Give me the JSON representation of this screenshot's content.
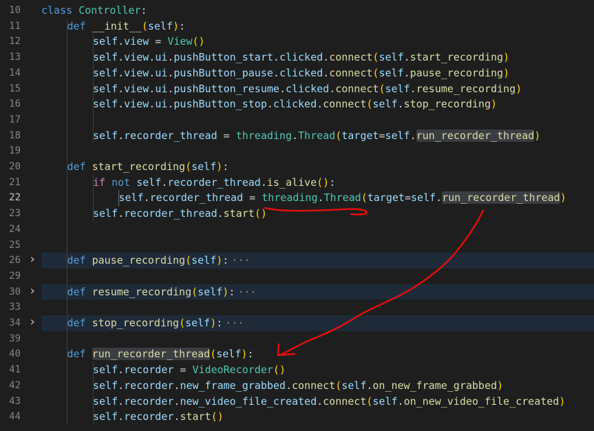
{
  "lines": [
    {
      "n": "10",
      "indent": 0,
      "tokens": [
        [
          "kw",
          "class"
        ],
        [
          "op",
          " "
        ],
        [
          "cls",
          "Controller"
        ],
        [
          "op",
          ":"
        ]
      ]
    },
    {
      "n": "11",
      "indent": 1,
      "tokens": [
        [
          "kw",
          "def"
        ],
        [
          "op",
          " "
        ],
        [
          "fn",
          "__init__"
        ],
        [
          "p1",
          "("
        ],
        [
          "var",
          "self"
        ],
        [
          "p1",
          ")"
        ],
        [
          "op",
          ":"
        ]
      ]
    },
    {
      "n": "12",
      "indent": 2,
      "tokens": [
        [
          "var",
          "self"
        ],
        [
          "op",
          "."
        ],
        [
          "var",
          "view"
        ],
        [
          "op",
          " = "
        ],
        [
          "cls",
          "View"
        ],
        [
          "p1",
          "()"
        ]
      ]
    },
    {
      "n": "13",
      "indent": 2,
      "tokens": [
        [
          "var",
          "self"
        ],
        [
          "op",
          "."
        ],
        [
          "var",
          "view"
        ],
        [
          "op",
          "."
        ],
        [
          "var",
          "ui"
        ],
        [
          "op",
          "."
        ],
        [
          "var",
          "pushButton_start"
        ],
        [
          "op",
          "."
        ],
        [
          "var",
          "clicked"
        ],
        [
          "op",
          "."
        ],
        [
          "fn",
          "connect"
        ],
        [
          "p1",
          "("
        ],
        [
          "var",
          "self"
        ],
        [
          "op",
          "."
        ],
        [
          "fn",
          "start_recording"
        ],
        [
          "p1",
          ")"
        ]
      ]
    },
    {
      "n": "14",
      "indent": 2,
      "tokens": [
        [
          "var",
          "self"
        ],
        [
          "op",
          "."
        ],
        [
          "var",
          "view"
        ],
        [
          "op",
          "."
        ],
        [
          "var",
          "ui"
        ],
        [
          "op",
          "."
        ],
        [
          "var",
          "pushButton_pause"
        ],
        [
          "op",
          "."
        ],
        [
          "var",
          "clicked"
        ],
        [
          "op",
          "."
        ],
        [
          "fn",
          "connect"
        ],
        [
          "p1",
          "("
        ],
        [
          "var",
          "self"
        ],
        [
          "op",
          "."
        ],
        [
          "fn",
          "pause_recording"
        ],
        [
          "p1",
          ")"
        ]
      ]
    },
    {
      "n": "15",
      "indent": 2,
      "tokens": [
        [
          "var",
          "self"
        ],
        [
          "op",
          "."
        ],
        [
          "var",
          "view"
        ],
        [
          "op",
          "."
        ],
        [
          "var",
          "ui"
        ],
        [
          "op",
          "."
        ],
        [
          "var",
          "pushButton_resume"
        ],
        [
          "op",
          "."
        ],
        [
          "var",
          "clicked"
        ],
        [
          "op",
          "."
        ],
        [
          "fn",
          "connect"
        ],
        [
          "p1",
          "("
        ],
        [
          "var",
          "self"
        ],
        [
          "op",
          "."
        ],
        [
          "fn",
          "resume_recording"
        ],
        [
          "p1",
          ")"
        ]
      ]
    },
    {
      "n": "16",
      "indent": 2,
      "tokens": [
        [
          "var",
          "self"
        ],
        [
          "op",
          "."
        ],
        [
          "var",
          "view"
        ],
        [
          "op",
          "."
        ],
        [
          "var",
          "ui"
        ],
        [
          "op",
          "."
        ],
        [
          "var",
          "pushButton_stop"
        ],
        [
          "op",
          "."
        ],
        [
          "var",
          "clicked"
        ],
        [
          "op",
          "."
        ],
        [
          "fn",
          "connect"
        ],
        [
          "p1",
          "("
        ],
        [
          "var",
          "self"
        ],
        [
          "op",
          "."
        ],
        [
          "fn",
          "stop_recording"
        ],
        [
          "p1",
          ")"
        ]
      ]
    },
    {
      "n": "17",
      "indent": 2,
      "tokens": []
    },
    {
      "n": "18",
      "indent": 2,
      "tokens": [
        [
          "var",
          "self"
        ],
        [
          "op",
          "."
        ],
        [
          "var",
          "recorder_thread"
        ],
        [
          "op",
          " = "
        ],
        [
          "cls",
          "threading"
        ],
        [
          "op",
          "."
        ],
        [
          "cls",
          "Thread"
        ],
        [
          "p1",
          "("
        ],
        [
          "var",
          "target"
        ],
        [
          "op",
          "="
        ],
        [
          "var",
          "self"
        ],
        [
          "op",
          "."
        ],
        [
          "fn",
          "run_recorder_thread",
          "hl"
        ],
        [
          "p1",
          ")"
        ]
      ]
    },
    {
      "n": "19",
      "indent": 1,
      "tokens": []
    },
    {
      "n": "20",
      "indent": 1,
      "tokens": [
        [
          "kw",
          "def"
        ],
        [
          "op",
          " "
        ],
        [
          "fn",
          "start_recording"
        ],
        [
          "p1",
          "("
        ],
        [
          "var",
          "self"
        ],
        [
          "p1",
          ")"
        ],
        [
          "op",
          ":"
        ]
      ]
    },
    {
      "n": "21",
      "indent": 2,
      "tokens": [
        [
          "ctl",
          "if"
        ],
        [
          "op",
          " "
        ],
        [
          "kw",
          "not"
        ],
        [
          "op",
          " "
        ],
        [
          "var",
          "self"
        ],
        [
          "op",
          "."
        ],
        [
          "var",
          "recorder_thread"
        ],
        [
          "op",
          "."
        ],
        [
          "fn",
          "is_alive"
        ],
        [
          "p1",
          "()"
        ],
        [
          "op",
          ":"
        ]
      ]
    },
    {
      "n": "22",
      "indent": 3,
      "active": true,
      "tokens": [
        [
          "var",
          "self"
        ],
        [
          "op",
          "."
        ],
        [
          "var",
          "recorder_thread"
        ],
        [
          "op",
          " = "
        ],
        [
          "cls",
          "threading"
        ],
        [
          "op",
          "."
        ],
        [
          "cls",
          "Thread"
        ],
        [
          "p1",
          "("
        ],
        [
          "var",
          "target"
        ],
        [
          "op",
          "="
        ],
        [
          "var",
          "self"
        ],
        [
          "op",
          "."
        ],
        [
          "fn",
          "run_recorder_thread",
          "hl"
        ],
        [
          "p1",
          ")"
        ]
      ]
    },
    {
      "n": "23",
      "indent": 2,
      "tokens": [
        [
          "var",
          "self"
        ],
        [
          "op",
          "."
        ],
        [
          "var",
          "recorder_thread"
        ],
        [
          "op",
          "."
        ],
        [
          "fn",
          "start"
        ],
        [
          "p1",
          "()"
        ]
      ]
    },
    {
      "n": "24",
      "indent": 1,
      "tokens": []
    },
    {
      "n": "25",
      "indent": 1,
      "tokens": []
    },
    {
      "n": "26",
      "indent": 1,
      "folded": true,
      "tokens": [
        [
          "kw",
          "def"
        ],
        [
          "op",
          " "
        ],
        [
          "fn",
          "pause_recording"
        ],
        [
          "p1",
          "("
        ],
        [
          "var",
          "self"
        ],
        [
          "p1",
          ")"
        ],
        [
          "op",
          ":"
        ],
        [
          "ell",
          "···"
        ]
      ]
    },
    {
      "n": "29",
      "indent": 1,
      "tokens": []
    },
    {
      "n": "30",
      "indent": 1,
      "folded": true,
      "tokens": [
        [
          "kw",
          "def"
        ],
        [
          "op",
          " "
        ],
        [
          "fn",
          "resume_recording"
        ],
        [
          "p1",
          "("
        ],
        [
          "var",
          "self"
        ],
        [
          "p1",
          ")"
        ],
        [
          "op",
          ":"
        ],
        [
          "ell",
          "···"
        ]
      ]
    },
    {
      "n": "33",
      "indent": 1,
      "tokens": []
    },
    {
      "n": "34",
      "indent": 1,
      "folded": true,
      "tokens": [
        [
          "kw",
          "def"
        ],
        [
          "op",
          " "
        ],
        [
          "fn",
          "stop_recording"
        ],
        [
          "p1",
          "("
        ],
        [
          "var",
          "self"
        ],
        [
          "p1",
          ")"
        ],
        [
          "op",
          ":"
        ],
        [
          "ell",
          "···"
        ]
      ]
    },
    {
      "n": "39",
      "indent": 1,
      "tokens": []
    },
    {
      "n": "40",
      "indent": 1,
      "tokens": [
        [
          "kw",
          "def"
        ],
        [
          "op",
          " "
        ],
        [
          "fn",
          "run_recorder_thread",
          "hl"
        ],
        [
          "p1",
          "("
        ],
        [
          "var",
          "self"
        ],
        [
          "p1",
          ")"
        ],
        [
          "op",
          ":"
        ]
      ]
    },
    {
      "n": "41",
      "indent": 2,
      "tokens": [
        [
          "var",
          "self"
        ],
        [
          "op",
          "."
        ],
        [
          "var",
          "recorder"
        ],
        [
          "op",
          " = "
        ],
        [
          "cls",
          "VideoRecorder"
        ],
        [
          "p1",
          "()"
        ]
      ]
    },
    {
      "n": "42",
      "indent": 2,
      "tokens": [
        [
          "var",
          "self"
        ],
        [
          "op",
          "."
        ],
        [
          "var",
          "recorder"
        ],
        [
          "op",
          "."
        ],
        [
          "var",
          "new_frame_grabbed"
        ],
        [
          "op",
          "."
        ],
        [
          "fn",
          "connect"
        ],
        [
          "p1",
          "("
        ],
        [
          "var",
          "self"
        ],
        [
          "op",
          "."
        ],
        [
          "fn",
          "on_new_frame_grabbed"
        ],
        [
          "p1",
          ")"
        ]
      ]
    },
    {
      "n": "43",
      "indent": 2,
      "tokens": [
        [
          "var",
          "self"
        ],
        [
          "op",
          "."
        ],
        [
          "var",
          "recorder"
        ],
        [
          "op",
          "."
        ],
        [
          "var",
          "new_video_file_created"
        ],
        [
          "op",
          "."
        ],
        [
          "fn",
          "connect"
        ],
        [
          "p1",
          "("
        ],
        [
          "var",
          "self"
        ],
        [
          "op",
          "."
        ],
        [
          "fn",
          "on_new_video_file_created"
        ],
        [
          "p1",
          ")"
        ]
      ]
    },
    {
      "n": "44",
      "indent": 2,
      "tokens": [
        [
          "var",
          "self"
        ],
        [
          "op",
          "."
        ],
        [
          "var",
          "recorder"
        ],
        [
          "op",
          "."
        ],
        [
          "fn",
          "start"
        ],
        [
          "p1",
          "()"
        ]
      ]
    }
  ],
  "colors": {
    "background": "#1e1e1e",
    "annotation": "#e01010",
    "folded_line_bg": "#1e2a38"
  },
  "icons": {
    "fold": "chevron-right-icon"
  }
}
